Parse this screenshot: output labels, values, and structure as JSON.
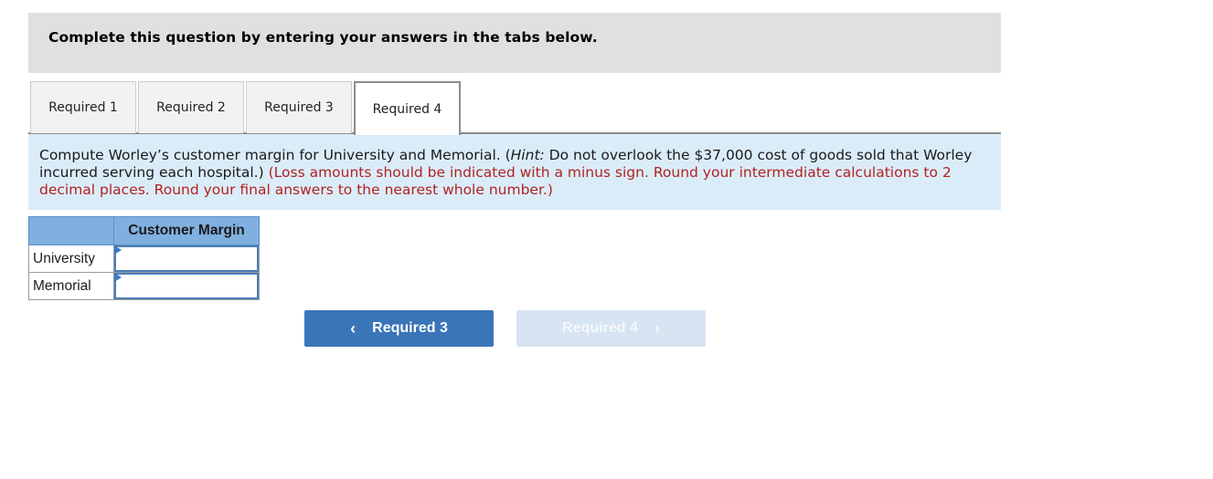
{
  "header": {
    "title": "Complete this question by entering your answers in the tabs below."
  },
  "tabs": [
    {
      "label": "Required 1",
      "active": false
    },
    {
      "label": "Required 2",
      "active": false
    },
    {
      "label": "Required 3",
      "active": false
    },
    {
      "label": "Required 4",
      "active": true
    }
  ],
  "instructions": {
    "main": "Compute Worley’s customer margin for University and Memorial. (",
    "hint_label": "Hint:",
    "hint_text": " Do not overlook the $37,000 cost of goods sold that Worley incurred serving each hospital.) ",
    "red_note": "(Loss amounts should be indicated with a minus sign.  Round your intermediate calculations to 2 decimal places.  Round your final answers to the nearest whole number.)"
  },
  "answer_table": {
    "column_header": "Customer Margin",
    "rows": [
      {
        "label": "University",
        "value": ""
      },
      {
        "label": "Memorial",
        "value": ""
      }
    ]
  },
  "navigation": {
    "prev_label": "Required 3",
    "next_label": "Required 4",
    "prev_icon": "‹",
    "next_icon": "›",
    "next_enabled": false
  },
  "colors": {
    "header_bg": "#e0e0e0",
    "instructions_bg": "#dbecf9",
    "red_text": "#b22222",
    "table_header_bg": "#7fb0e0",
    "primary_button": "#3a75b8",
    "disabled_button": "#d7e4f2"
  }
}
